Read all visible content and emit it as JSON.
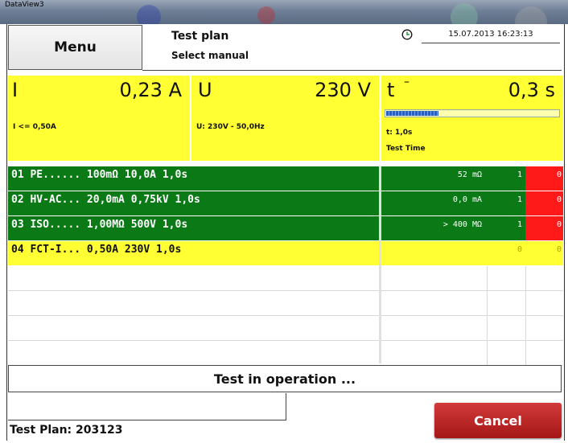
{
  "window": {
    "title": "DataView3"
  },
  "header": {
    "menu_label": "Menu",
    "plan_title": "Test plan",
    "plan_subtitle": "Select manual",
    "datetime": "15.07.2013  16:23:13"
  },
  "panels": {
    "current": {
      "symbol": "I",
      "value": "0,23 A",
      "detail": "I <= 0,50A"
    },
    "voltage": {
      "symbol": "U",
      "value": "230 V",
      "detail": "U: 230V - 50,0Hz"
    },
    "time": {
      "symbol": "t",
      "superscript": "–",
      "value": "0,3 s",
      "detail1": "t: 1,0s",
      "detail2": "Test Time",
      "progress": 0.3
    }
  },
  "steps": [
    {
      "name": "01 PE...... 100mΩ 10,0A 1,0s",
      "measured": "52 mΩ",
      "count_a": "1",
      "count_b": "0",
      "state": "pass"
    },
    {
      "name": "02 HV-AC... 20,0mA 0,75kV 1,0s",
      "measured": "0,0 mA",
      "count_a": "1",
      "count_b": "0",
      "state": "pass"
    },
    {
      "name": "03 ISO..... 1,00MΩ 500V 1,0s",
      "measured": "> 400 MΩ",
      "count_a": "1",
      "count_b": "0",
      "state": "pass"
    },
    {
      "name": "04 FCT-I... 0,50A 230V 1,0s",
      "measured": "",
      "count_a": "0",
      "count_b": "0",
      "state": "running"
    }
  ],
  "status": {
    "text": "Test in operation ..."
  },
  "footer": {
    "plan_label": "Test Plan: 203123",
    "cancel_label": "Cancel"
  },
  "colors": {
    "pass": "#0b7a16",
    "running": "#ffff33",
    "fail": "#ff1a1a",
    "accent": "#b51f1f"
  }
}
